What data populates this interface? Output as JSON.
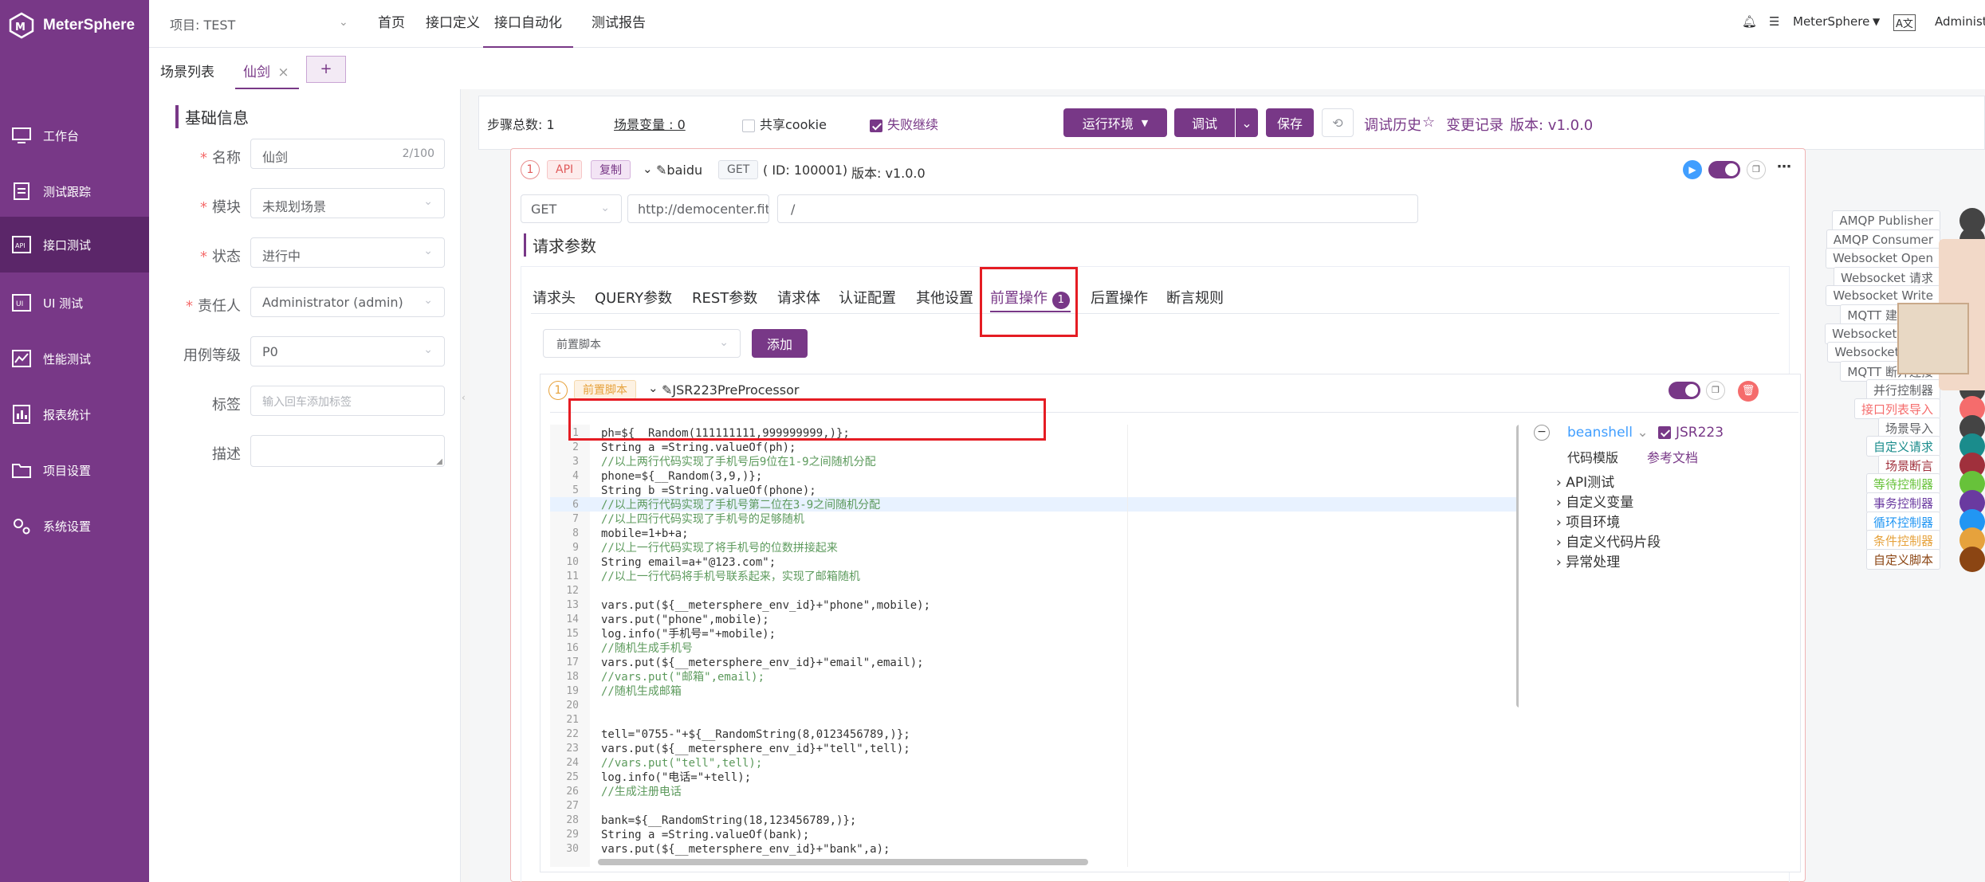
{
  "brand": "MeterSphere",
  "sidebar": {
    "items": [
      {
        "label": "工作台",
        "icon": "desktop-icon"
      },
      {
        "label": "测试跟踪",
        "icon": "clipboard-icon"
      },
      {
        "label": "接口测试",
        "icon": "api-icon",
        "active": true
      },
      {
        "label": "UI 测试",
        "icon": "ui-icon"
      },
      {
        "label": "性能测试",
        "icon": "chart-icon"
      },
      {
        "label": "报表统计",
        "icon": "report-icon"
      },
      {
        "label": "项目设置",
        "icon": "folder-icon"
      },
      {
        "label": "系统设置",
        "icon": "gear-icon"
      }
    ]
  },
  "topbar": {
    "project": "项目: TEST",
    "nav": [
      "首页",
      "接口定义",
      "接口自动化",
      "测试报告"
    ],
    "active": "接口自动化",
    "right": {
      "workspace": "MeterSphere",
      "user": "Administrator"
    }
  },
  "scene_tabs": {
    "list": "场景列表",
    "current": "仙剑",
    "add": "+"
  },
  "basic": {
    "title": "基础信息",
    "name_label": "名称",
    "name_value": "仙剑",
    "name_count": "2/100",
    "module_label": "模块",
    "module_value": "未规划场景",
    "status_label": "状态",
    "status_value": "进行中",
    "owner_label": "责任人",
    "owner_value": "Administrator (admin)",
    "level_label": "用例等级",
    "level_value": "P0",
    "tag_label": "标签",
    "tag_placeholder": "输入回车添加标签",
    "desc_label": "描述"
  },
  "scenario_bar": {
    "steps": "步骤总数: 1",
    "vars": "场景变量 : 0",
    "share_cookie": "共享cookie",
    "continue_fail": "失败继续",
    "run_env": "运行环境",
    "debug": "调试",
    "save": "保存",
    "history": "调试历史",
    "changes": "变更记录",
    "version": "版本: v1.0.0"
  },
  "api_card": {
    "index": "1",
    "type": "API",
    "copy": "复制",
    "name": "baidu",
    "method": "GET",
    "id": "( ID: 100001)",
    "version": "版本: v1.0.0",
    "req_method": "GET",
    "url": "http://democenter.fit2",
    "path": "/",
    "section": "请求参数"
  },
  "tabs": [
    "请求头",
    "QUERY参数",
    "REST参数",
    "请求体",
    "认证配置",
    "其他设置",
    "前置操作",
    "后置操作",
    "断言规则"
  ],
  "active_tab_badge": "1",
  "pre": {
    "select": "前置脚本",
    "add": "添加",
    "index": "1",
    "tag": "前置脚本",
    "name": "JSR223PreProcessor"
  },
  "lang": {
    "beanshell": "beanshell",
    "jsr": "JSR223",
    "template": "代码模版",
    "doc": "参考文档",
    "tree": [
      "API测试",
      "自定义变量",
      "项目环境",
      "自定义代码片段",
      "异常处理"
    ]
  },
  "code": [
    "ph=${__Random(111111111,999999999,)};",
    "String a =String.valueOf(ph);",
    "//以上两行代码实现了手机号后9位在1-9之间随机分配",
    "phone=${__Random(3,9,)};",
    "String b =String.valueOf(phone);",
    "//以上两行代码实现了手机号第二位在3-9之间随机分配",
    "//以上四行代码实现了手机号的足够随机",
    "mobile=1+b+a;",
    "//以上一行代码实现了将手机号的位数拼接起来",
    "String email=a+\"@123.com\";",
    "//以上一行代码将手机号联系起来，实现了邮箱随机",
    "",
    "vars.put(${__metersphere_env_id}+\"phone\",mobile);",
    "vars.put(\"phone\",mobile);",
    "log.info(\"手机号=\"+mobile);",
    "//随机生成手机号",
    "vars.put(${__metersphere_env_id}+\"email\",email);",
    "//vars.put(\"邮箱\",email);",
    "//随机生成邮箱",
    "",
    "",
    "tell=\"0755-\"+${__RandomString(8,0123456789,)};",
    "vars.put(${__metersphere_env_id}+\"tell\",tell);",
    "//vars.put(\"tell\",tell);",
    "log.info(\"电话=\"+tell);",
    "//生成注册电话",
    "",
    "bank=${__RandomString(18,123456789,)};",
    "String a =String.valueOf(bank);",
    "vars.put(${__metersphere_env_id}+\"bank\",a);"
  ],
  "palette": [
    {
      "label": "AMQP Publisher",
      "color": "#606266"
    },
    {
      "label": "AMQP Consumer",
      "color": "#606266"
    },
    {
      "label": "Websocket Open",
      "color": "#606266"
    },
    {
      "label": "Websocket 请求",
      "color": "#606266"
    },
    {
      "label": "Websocket Write",
      "color": "#606266"
    },
    {
      "label": "MQTT 建立连接",
      "color": "#606266"
    },
    {
      "label": "Websocket Close",
      "color": "#606266"
    },
    {
      "label": "Websocket Read",
      "color": "#606266"
    },
    {
      "label": "MQTT 断开连接",
      "color": "#606266"
    },
    {
      "label": "并行控制器",
      "color": "#606266"
    },
    {
      "label": "接口列表导入",
      "color": "#f56c6c"
    },
    {
      "label": "场景导入",
      "color": "#606266"
    },
    {
      "label": "自定义请求",
      "color": "#1a8c8c"
    },
    {
      "label": "场景断言",
      "color": "#a0303c"
    },
    {
      "label": "等待控制器",
      "color": "#67c23a"
    },
    {
      "label": "事务控制器",
      "color": "#6a3aa0"
    },
    {
      "label": "循环控制器",
      "color": "#2196f3"
    },
    {
      "label": "条件控制器",
      "color": "#e6a23c"
    },
    {
      "label": "自定义脚本",
      "color": "#8b4513"
    }
  ]
}
